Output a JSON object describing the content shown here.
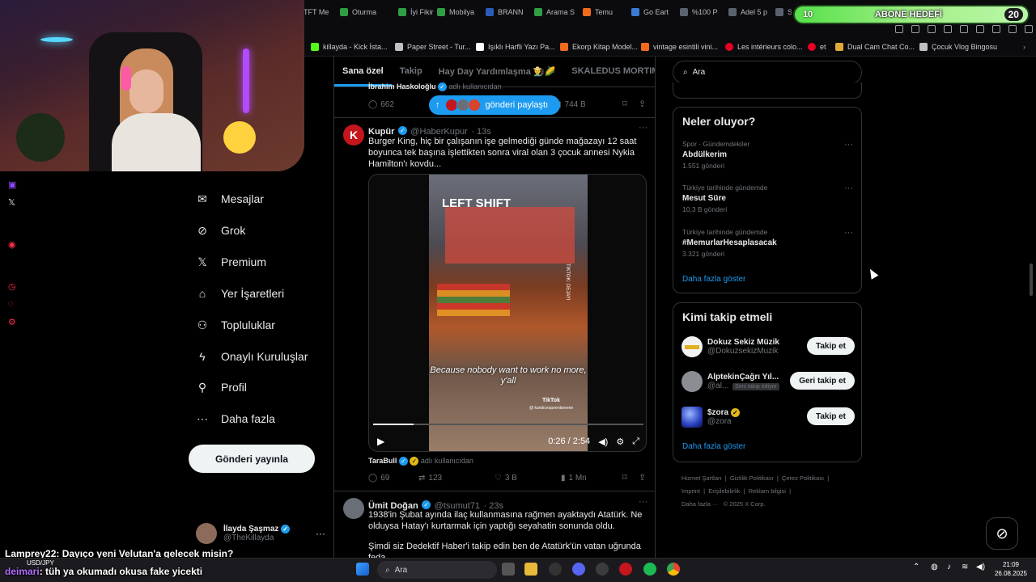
{
  "browser": {
    "tabs": [
      {
        "label": "TFT Me",
        "color": "#2b2b2b"
      },
      {
        "label": "Oturma",
        "color": "#2f9e44"
      },
      {
        "label": "İyi Fikir",
        "color": "#2f9e44"
      },
      {
        "label": "Mobilya",
        "color": "#2f9e44"
      },
      {
        "label": "BRANN",
        "color": "#2b5db8"
      },
      {
        "label": "Arama S",
        "color": "#2f9e44"
      },
      {
        "label": "Temu",
        "color": "#f26b1d"
      },
      {
        "label": "Go Eart",
        "color": "#3a7bd5"
      },
      {
        "label": "%100 P",
        "color": "#5a6270"
      },
      {
        "label": "Adel 5 p",
        "color": "#5a6270"
      },
      {
        "label": "S",
        "color": "#5a6270"
      }
    ],
    "bookmarks": [
      {
        "label": "killayda - Kick İsta...",
        "color": "#53fc18"
      },
      {
        "label": "Paper Street - Tur...",
        "color": "#c0c0c0"
      },
      {
        "label": "Işıklı Harfli Yazı Pa...",
        "color": "#ffffff"
      },
      {
        "label": "Ekorp Kitap Model...",
        "color": "#f26b1d"
      },
      {
        "label": "vintage esintili vini...",
        "color": "#f26b1d"
      },
      {
        "label": "Les intérieurs colo...",
        "color": "#e60023"
      },
      {
        "label": "et",
        "color": "#e60023"
      },
      {
        "label": "Dual Cam Chat Co...",
        "color": "#e0a93b"
      },
      {
        "label": "Çocuk Vlog Bingosu",
        "color": "#c0c0c0"
      }
    ]
  },
  "goal": {
    "left_count": "10",
    "label": "ABONE HEDEFİ",
    "right_count": "20"
  },
  "nav": {
    "items": [
      {
        "label": "Mesajlar",
        "icon": "mail-icon"
      },
      {
        "label": "Grok",
        "icon": "grok-icon"
      },
      {
        "label": "Premium",
        "icon": "x-logo-icon"
      },
      {
        "label": "Yer İşaretleri",
        "icon": "bookmark-icon"
      },
      {
        "label": "Topluluklar",
        "icon": "communities-icon"
      },
      {
        "label": "Onaylı Kuruluşlar",
        "icon": "lightning-icon"
      },
      {
        "label": "Profil",
        "icon": "person-icon"
      },
      {
        "label": "Daha fazla",
        "icon": "more-circle-icon"
      }
    ],
    "post_button": "Gönderi yayınla",
    "account": {
      "name": "İlayda Şaşmaz",
      "handle": "@TheKillayda"
    }
  },
  "feed": {
    "tabs": [
      "Sana özel",
      "Takip",
      "Hay Day Yardımlaşma 👨‍🌾🌽",
      "SKALEDUS MORTIMAS"
    ],
    "new_posts": "gönderi paylaştı",
    "prev_tweet": {
      "reposted_by": "İbrahim Haskoloğlu",
      "reposted_suffix": "adlı kullanıcıdan",
      "replies": "662",
      "views": "744 B"
    },
    "tweet1": {
      "name": "Kupür",
      "handle": "@HaberKupur",
      "time": "· 13s",
      "text": "Burger King, hiç bir çalışanın işe gelmediği günde mağazayı 12 saat boyunca tek başına işlettikten sonra viral olan 3 çocuk annesi Nykia Hamilton'ı kovdu...",
      "video": {
        "overlay_top": "LEFT SHIFT",
        "caption": "Because nobody want to work no more, y'all",
        "watermark": "TikTok",
        "watermark_handle": "@ kandicequeenbeeeee",
        "side_text": "TIKTOK: DEJAYI",
        "time": "0:26 / 2:54",
        "progress": 0.15
      },
      "attribution": "TaraBull",
      "attribution_suffix": "adlı kullanıcıdan",
      "replies": "69",
      "reposts": "123",
      "likes": "3 B",
      "views": "1 Mn"
    },
    "tweet2": {
      "name": "Ümit Doğan",
      "handle": "@tsumut71",
      "time": "· 23s",
      "text1": "1938'in Şubat ayında ilaç kullanmasına rağmen ayaktaydı Atatürk. Ne olduysa Hatay'ı kurtarmak için yaptığı seyahatin sonunda oldu.",
      "text2": "Şimdi siz Dedektif Haber'i takip edin ben de Atatürk'ün vatan uğrunda feda"
    }
  },
  "right": {
    "search_placeholder": "Ara",
    "trends_title": "Neler oluyor?",
    "trends": [
      {
        "sub": "Spor · Gündemdekiler",
        "title": "Abdülkerim",
        "count": "1.551 gönderi"
      },
      {
        "sub": "Türkiye tarihinde gündemde",
        "title": "Mesut Süre",
        "count": "10,3 B gönderi"
      },
      {
        "sub": "Türkiye tarihinde gündemde",
        "title": "#MemurlarHesaplasacak",
        "count": "3.321 gönderi"
      }
    ],
    "trends_more": "Daha fazla göster",
    "wtf_title": "Kimi takip etmeli",
    "wtf": [
      {
        "name": "Dokuz Sekiz Müzik",
        "handle": "@DokuzsekizMuzik",
        "button": "Takip et",
        "follows_you": ""
      },
      {
        "name": "AlptekinÇağrı Yıl...",
        "handle": "@al...",
        "button": "Geri takip et",
        "follows_you": "Seni takip ediyor"
      },
      {
        "name": "$zora",
        "handle": "@zora",
        "button": "Takip et",
        "follows_you": ""
      }
    ],
    "wtf_more": "Daha fazla göster",
    "footer": {
      "links": [
        "Hizmet Şartları",
        "Gizlilik Politikası",
        "Çerez Politikası",
        "Imprint",
        "Erişilebilirlik",
        "Reklam bilgisi",
        "Daha fazla ···"
      ],
      "copyright": "© 2025 X Corp."
    }
  },
  "chat": [
    {
      "user": "Lamprey22",
      "message": ": Dayıço yeni Velutan'a gelecek misin?",
      "color": "#ffffff"
    },
    {
      "user": "deimari",
      "message": ": tüh ya okumadı okusa fake yicekti",
      "color": "#b06bff"
    }
  ],
  "taskbar": {
    "search": "Ara",
    "time": "21:09",
    "date": "26.08.2025",
    "ticker": "USD/JPY"
  },
  "colors": {
    "accent": "#1d9bf0",
    "background": "#000000",
    "border": "#2f3336",
    "muted": "#71767b"
  }
}
